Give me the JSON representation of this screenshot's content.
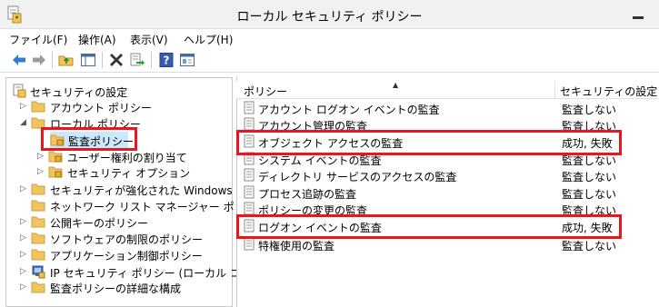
{
  "window": {
    "title": "ローカル セキュリティ ポリシー",
    "minimize_label": "—"
  },
  "menu": [
    "ファイル(F)",
    "操作(A)",
    "表示(V)",
    "ヘルプ(H)"
  ],
  "toolbar": {
    "icons": [
      "back-arrow-icon",
      "forward-arrow-icon",
      "folder-up-icon",
      "show-tree-icon",
      "delete-x-icon",
      "export-list-icon",
      "help-icon",
      "properties-icon"
    ]
  },
  "tree": {
    "root": "セキュリティの設定",
    "items": [
      {
        "label": "アカウント ポリシー",
        "expanded": false
      },
      {
        "label": "ローカル ポリシー",
        "expanded": true
      },
      {
        "label": "監査ポリシー",
        "selected": true
      },
      {
        "label": "ユーザー権利の割り当て"
      },
      {
        "label": "セキュリティ オプション"
      },
      {
        "label": "セキュリティが強化された Windows ファイ"
      },
      {
        "label": "ネットワーク リスト マネージャー ポリシー"
      },
      {
        "label": "公開キーのポリシー"
      },
      {
        "label": "ソフトウェアの制限のポリシー"
      },
      {
        "label": "アプリケーション制御ポリシー"
      },
      {
        "label": "IP セキュリティ ポリシー (ローカル コンピュー"
      },
      {
        "label": "監査ポリシーの詳細な構成"
      }
    ]
  },
  "list": {
    "columns": [
      "ポリシー",
      "セキュリティの設定"
    ],
    "rows": [
      {
        "name": "アカウント ログオン イベントの監査",
        "setting": "監査しない"
      },
      {
        "name": "アカウント管理の監査",
        "setting": "監査しない"
      },
      {
        "name": "オブジェクト アクセスの監査",
        "setting": "成功, 失敗"
      },
      {
        "name": "システム イベントの監査",
        "setting": "監査しない"
      },
      {
        "name": "ディレクトリ サービスのアクセスの監査",
        "setting": "監査しない"
      },
      {
        "name": "プロセス追跡の監査",
        "setting": "監査しない"
      },
      {
        "name": "ポリシーの変更の監査",
        "setting": "監査しない"
      },
      {
        "name": "ログオン イベントの監査",
        "setting": "成功, 失敗"
      },
      {
        "name": "特権使用の監査",
        "setting": "監査しない"
      }
    ]
  },
  "colors": {
    "highlight_red": "#e8161e",
    "selection_blue": "#cce8ff",
    "folder_yellow": "#f2c55c"
  }
}
